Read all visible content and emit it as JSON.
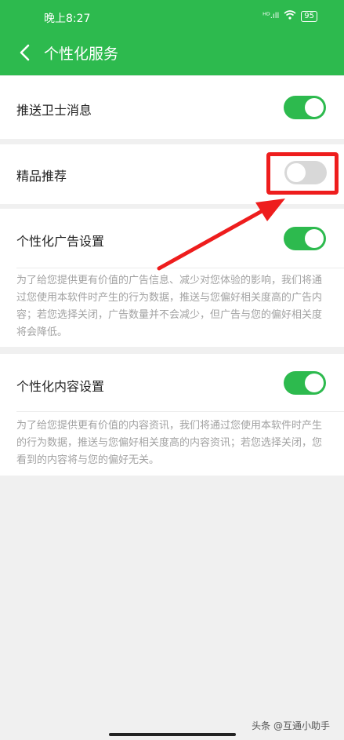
{
  "status_bar": {
    "time": "晚上8:27",
    "signal": "ᴴᴰ.ıll",
    "battery": "95"
  },
  "header": {
    "title": "个性化服务"
  },
  "settings": {
    "push_guard": {
      "label": "推送卫士消息",
      "enabled": true
    },
    "recommend": {
      "label": "精品推荐",
      "enabled": false
    },
    "ad": {
      "label": "个性化广告设置",
      "enabled": true,
      "description": "为了给您提供更有价值的广告信息、减少对您体验的影响，我们将通过您使用本软件时产生的行为数据，推送与您偏好相关度高的广告内容；若您选择关闭，广告数量并不会减少，但广告与您的偏好相关度将会降低。"
    },
    "content": {
      "label": "个性化内容设置",
      "enabled": true,
      "description": "为了给您提供更有价值的内容资讯，我们将通过您使用本软件时产生的行为数据，推送与您偏好相关度高的内容资讯；若您选择关闭，您看到的内容将与您的偏好无关。"
    }
  },
  "colors": {
    "accent": "#2dba4e",
    "highlight": "#ee1d1d",
    "toggle_off": "#d8d8d8"
  },
  "watermark": "头条 @互通小助手"
}
